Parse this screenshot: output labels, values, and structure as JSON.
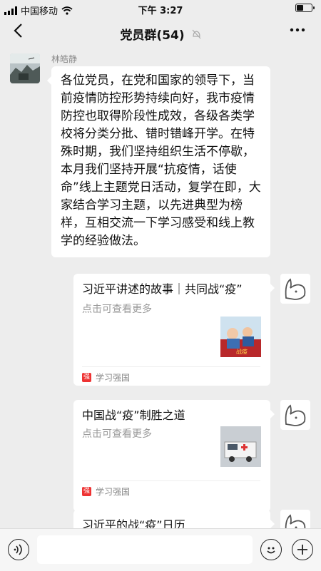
{
  "status": {
    "carrier": "中国移动",
    "time": "下午 3:27"
  },
  "nav": {
    "back_icon": "chevron-left-icon",
    "title": "党员群(54)",
    "mute_icon": "bell-off-icon",
    "more_icon": "more-dots-icon"
  },
  "messages": {
    "m1": {
      "sender": "林皓静",
      "text": "各位党员，在党和国家的领导下，当前疫情防控形势持续向好，我市疫情防控也取得阶段性成效，各级各类学校将分类分批、错时错峰开学。在特殊时期，我们坚持组织生活不停歇，本月我们坚持开展“抗疫情，话使命”线上主题党日活动，复学在即，大家结合学习主题，以先进典型为榜样，互相交流一下学习感受和线上教学的经验做法。"
    },
    "c1": {
      "title": "习近平讲述的故事｜共同战“疫”",
      "desc": "点击可查看更多",
      "source": "学习强国"
    },
    "c2": {
      "title": "中国战“疫”制胜之道",
      "desc": "点击可查看更多",
      "source": "学习强国"
    },
    "c3": {
      "title": "习近平的战“疫”日历"
    }
  },
  "input": {
    "voice_icon": "voice-icon",
    "emoji_icon": "emoji-icon",
    "plus_icon": "plus-icon"
  }
}
